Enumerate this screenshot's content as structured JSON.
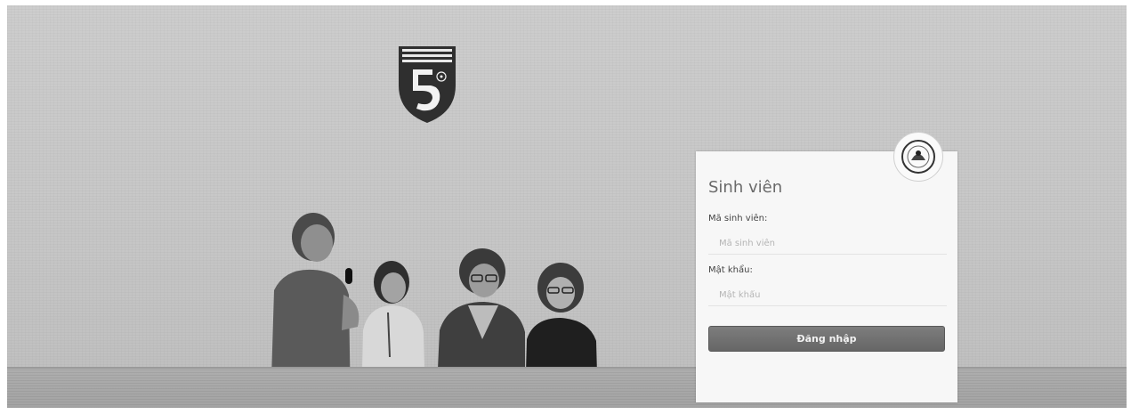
{
  "login": {
    "title": "Sinh viên",
    "student_id_label": "Mã sinh viên:",
    "student_id_placeholder": "Mã sinh viên",
    "password_label": "Mật khẩu:",
    "password_placeholder": "Mật khẩu",
    "submit_label": "Đăng nhập"
  },
  "icons": {
    "crest": "university-crest-logo",
    "badge": "club-badge-logo"
  }
}
